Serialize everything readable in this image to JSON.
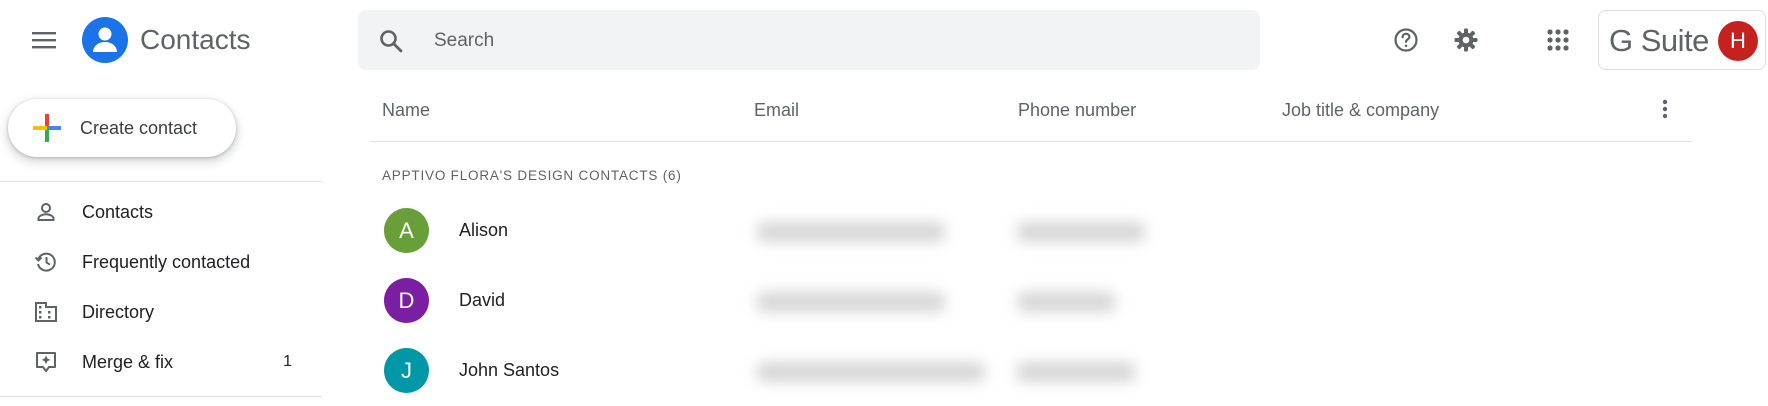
{
  "header": {
    "app_title": "Contacts",
    "search_placeholder": "Search",
    "gsuite_label": "G Suite",
    "account_initial": "H"
  },
  "sidebar": {
    "create_label": "Create contact",
    "items": [
      {
        "label": "Contacts",
        "icon": "person-icon",
        "count": ""
      },
      {
        "label": "Frequently contacted",
        "icon": "history-icon",
        "count": ""
      },
      {
        "label": "Directory",
        "icon": "building-icon",
        "count": ""
      },
      {
        "label": "Merge & fix",
        "icon": "merge-fix-icon",
        "count": "1"
      }
    ]
  },
  "table": {
    "columns": [
      "Name",
      "Email",
      "Phone number",
      "Job title & company"
    ],
    "section_label": "APPTIVO FLORA'S DESIGN CONTACTS (6)",
    "rows": [
      {
        "initial": "A",
        "name": "Alison",
        "color": "#689f38"
      },
      {
        "initial": "D",
        "name": "David",
        "color": "#7b1fa2"
      },
      {
        "initial": "J",
        "name": "John Santos",
        "color": "#0097a7"
      }
    ]
  },
  "colors": {
    "accent": "#1a73e8",
    "search_bg": "#f1f3f4",
    "account_avatar": "#c5221f"
  }
}
